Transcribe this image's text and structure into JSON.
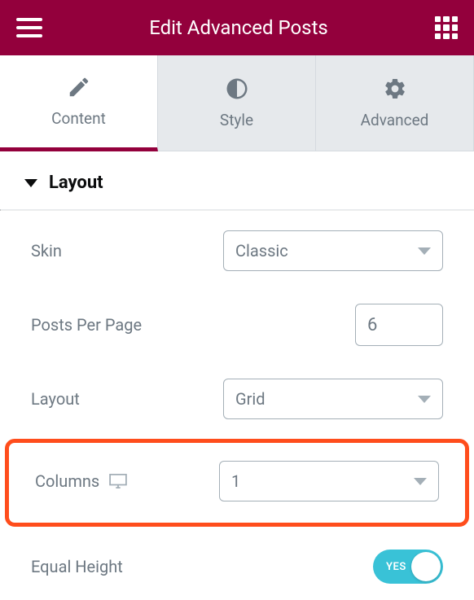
{
  "header": {
    "title": "Edit Advanced Posts"
  },
  "tabs": {
    "content": "Content",
    "style": "Style",
    "advanced": "Advanced"
  },
  "section": {
    "title": "Layout"
  },
  "controls": {
    "skin": {
      "label": "Skin",
      "value": "Classic"
    },
    "postsPerPage": {
      "label": "Posts Per Page",
      "value": "6"
    },
    "layout": {
      "label": "Layout",
      "value": "Grid"
    },
    "columns": {
      "label": "Columns",
      "value": "1"
    },
    "equalHeight": {
      "label": "Equal Height",
      "toggle": "YES"
    }
  }
}
